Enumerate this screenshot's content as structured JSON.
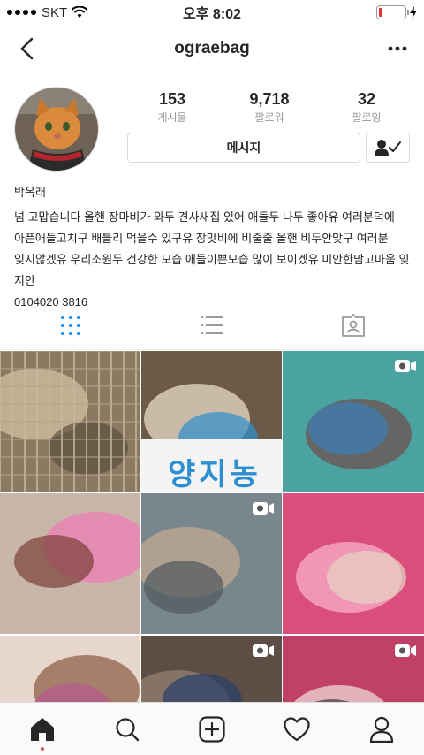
{
  "status_bar": {
    "carrier": "SKT",
    "time": "오후 8:02",
    "battery_level": 0.15,
    "battery_color": "#e33333"
  },
  "header": {
    "username": "ograebag",
    "back_icon": "chevron-left-icon",
    "more_icon": "more-horizontal-icon"
  },
  "profile": {
    "avatar_icon": "cat-avatar",
    "stats": [
      {
        "value": "153",
        "label": "게시물"
      },
      {
        "value": "9,718",
        "label": "팔로워"
      },
      {
        "value": "32",
        "label": "팔로잉"
      }
    ],
    "message_label": "메시지",
    "following_icon": "user-check-icon"
  },
  "bio": {
    "name": "박옥래",
    "lines": [
      "넘 고맙습니다 올핸 장마비가 와두 견사새집 있어 애들두 나두 좋아유 여러분덕에",
      "아픈애들고치구 배블리 먹을수 있구유 장맛비에 비줄줄 올핸 비두안맞구 여러분",
      "잊지않겠유 우리소원두 건강한 모습 애들이쁜모습 많이 보이겠유 미안한맘고마움 잊지안",
      "0104020 3816"
    ]
  },
  "tabs": [
    {
      "name": "grid",
      "icon": "grid-icon",
      "active": true
    },
    {
      "name": "list",
      "icon": "list-icon",
      "active": false
    },
    {
      "name": "tagged",
      "icon": "tagged-icon",
      "active": false
    }
  ],
  "grid_posts": [
    {
      "type": "photo",
      "palette": [
        "#8a7a62",
        "#c9b89a",
        "#5e503e"
      ]
    },
    {
      "type": "photo",
      "palette": [
        "#6b5a48",
        "#d9cdb8",
        "#2d8fcf"
      ],
      "sign_text": "양지농"
    },
    {
      "type": "video",
      "palette": [
        "#4aa3a0",
        "#6a5a58",
        "#3b7fb8"
      ]
    },
    {
      "type": "photo",
      "palette": [
        "#c8b6a8",
        "#e985b3",
        "#7a4036"
      ]
    },
    {
      "type": "video",
      "palette": [
        "#7a868e",
        "#b9a48f",
        "#4f585e"
      ]
    },
    {
      "type": "photo",
      "palette": [
        "#d94e7b",
        "#f4a3c0",
        "#e6d4c3"
      ]
    },
    {
      "type": "photo",
      "palette": [
        "#e7d6cc",
        "#9a7058",
        "#b85a8e"
      ]
    },
    {
      "type": "video",
      "palette": [
        "#5c4e44",
        "#8c7a6a",
        "#2a3e6a"
      ]
    },
    {
      "type": "video",
      "palette": [
        "#c04068",
        "#e8c8c8",
        "#4a3a3a"
      ]
    }
  ],
  "bottom_nav": [
    {
      "name": "home",
      "icon": "home-icon",
      "active": true
    },
    {
      "name": "search",
      "icon": "search-icon",
      "active": false
    },
    {
      "name": "add",
      "icon": "add-post-icon",
      "active": false
    },
    {
      "name": "activity",
      "icon": "heart-icon",
      "active": false
    },
    {
      "name": "profile",
      "icon": "profile-icon",
      "active": false
    }
  ]
}
